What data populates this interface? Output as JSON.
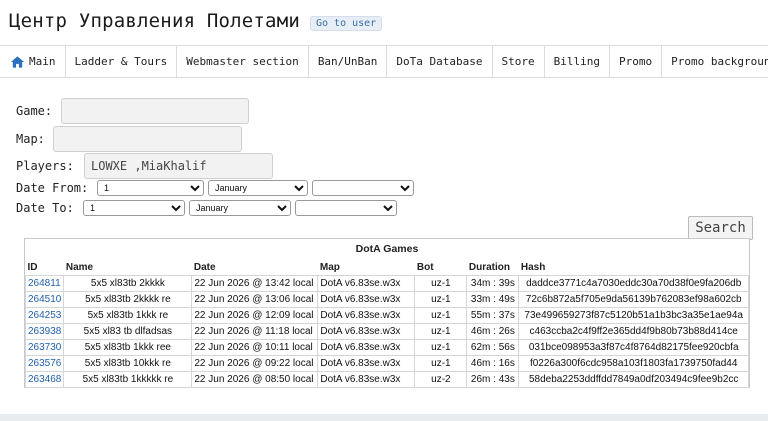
{
  "header": {
    "title": "Центр Управления Полетами",
    "goto_user": "Go to user"
  },
  "nav": {
    "items": [
      {
        "label": "Main",
        "icon": "home-icon"
      },
      {
        "label": "Ladder & Tours"
      },
      {
        "label": "Webmaster section"
      },
      {
        "label": "Ban/UnBan"
      },
      {
        "label": "DoTa Database"
      },
      {
        "label": "Store"
      },
      {
        "label": "Billing"
      },
      {
        "label": "Promo"
      },
      {
        "label": "Promo background"
      }
    ]
  },
  "filters": {
    "game_label": "Game:",
    "game_value": "",
    "map_label": "Map:",
    "map_value": "",
    "players_label": "Players:",
    "players_value": "LOWXE ,MiaKhalif",
    "date_from_label": "Date From:",
    "date_from_day": "1",
    "date_from_month": "January",
    "date_from_year": "",
    "date_to_label": "Date To:",
    "date_to_day": "1",
    "date_to_month": "January",
    "date_to_year": "",
    "search_label": "Search"
  },
  "games": {
    "caption": "DotA Games",
    "columns": [
      "ID",
      "Name",
      "Date",
      "Map",
      "Bot",
      "Duration",
      "Hash"
    ],
    "rows": [
      [
        "264811",
        "5x5 xl83tb 2kkkk",
        "22 Jun 2026 @ 13:42 local",
        "DotA v6.83se.w3x",
        "uz-1",
        "34m : 39s",
        "daddce3771c4a7030eddc30a70d38f0e9fa206db"
      ],
      [
        "264510",
        "5x5 xl83tb 2kkkk re",
        "22 Jun 2026 @ 13:06 local",
        "DotA v6.83se.w3x",
        "uz-1",
        "33m : 49s",
        "72c6b872a5f705e9da56139b762083ef98a602cb"
      ],
      [
        "264253",
        "5x5 xl83tb 1kkk re",
        "22 Jun 2026 @ 12:09 local",
        "DotA v6.83se.w3x",
        "uz-1",
        "55m : 37s",
        "73e499659273f87c5120b51a1b3bc3a35e1ae94a"
      ],
      [
        "263938",
        "5x5 xl83 tb dlfadsas",
        "22 Jun 2026 @ 11:18 local",
        "DotA v6.83se.w3x",
        "uz-1",
        "46m : 26s",
        "c463ccba2c4f9ff2e365dd4f9b80b73b88d414ce"
      ],
      [
        "263730",
        "5x5 xl83tb 1kkk ree",
        "22 Jun 2026 @ 10:11 local",
        "DotA v6.83se.w3x",
        "uz-1",
        "62m : 56s",
        "031bce098953a3f87c4f8764d82175fee920cbfa"
      ],
      [
        "263576",
        "5x5 xl83tb 10kkk re",
        "22 Jun 2026 @ 09:22 local",
        "DotA v6.83se.w3x",
        "uz-1",
        "46m : 16s",
        "f0226a300f6cdc958a103f1803fa1739750fad44"
      ],
      [
        "263468",
        "5x5 xl83tb 1kkkkk re",
        "22 Jun 2026 @ 08:50 local",
        "DotA v6.83se.w3x",
        "uz-2",
        "26m : 43s",
        "58deba2253ddffdd7849a0df203494c9fee9b2cc"
      ]
    ]
  },
  "colors": {
    "link": "#1f5fa8",
    "nav_icon": "#2a6fc0"
  }
}
